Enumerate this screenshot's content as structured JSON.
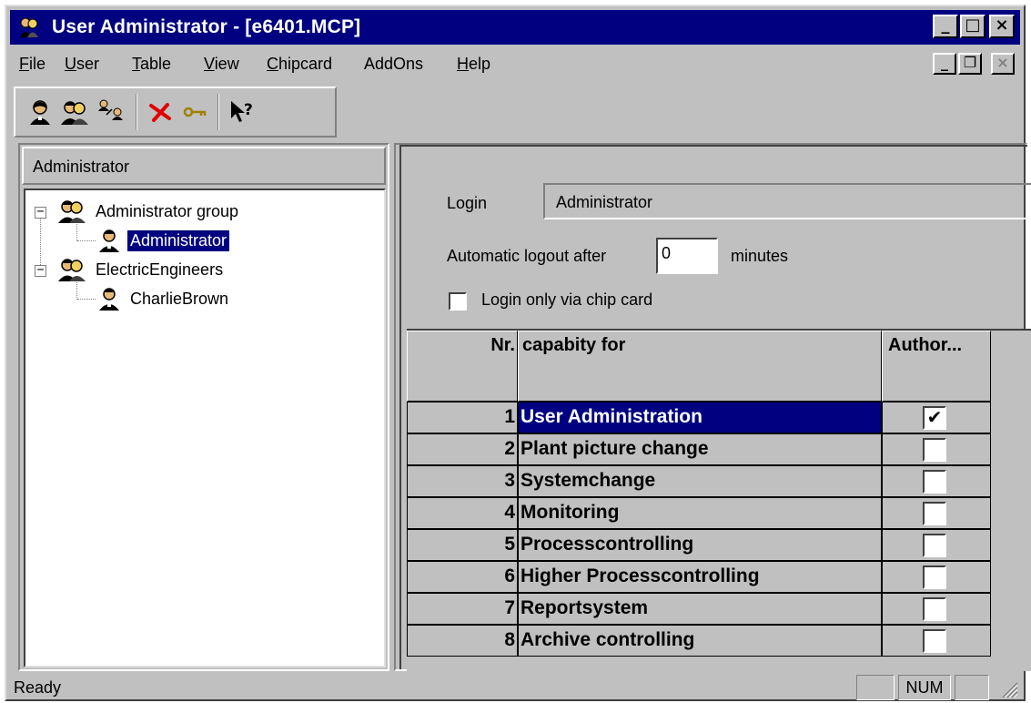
{
  "window": {
    "title": "User Administrator - [e6401.MCP]",
    "icon": "user-admin-app-icon",
    "controls": {
      "minimize": "_",
      "maximize": "□",
      "close": "×"
    }
  },
  "menubar": {
    "items": [
      {
        "first": "F",
        "rest": "ile"
      },
      {
        "first": "U",
        "rest": "ser"
      },
      {
        "first": "T",
        "rest": "able"
      },
      {
        "first": "V",
        "rest": "iew"
      },
      {
        "first": "C",
        "rest": "hipcard"
      },
      {
        "first": "",
        "rest": "AddOns"
      },
      {
        "first": "H",
        "rest": "elp"
      }
    ],
    "mdi_controls": {
      "minimize": "_",
      "restore": "❐",
      "close": "×"
    }
  },
  "toolbar": {
    "buttons": [
      "new-user-icon",
      "new-group-icon",
      "user-properties-icon",
      "delete-icon",
      "key-icon",
      "context-help-icon"
    ]
  },
  "left_pane": {
    "header": "Administrator",
    "tree": [
      {
        "label": "Administrator group",
        "type": "group",
        "expanded": true
      },
      {
        "label": "Administrator",
        "type": "user",
        "selected": true
      },
      {
        "label": "ElectricEngineers",
        "type": "group",
        "expanded": true
      },
      {
        "label": "CharlieBrown",
        "type": "user",
        "selected": false
      }
    ],
    "expander_symbol": "−"
  },
  "form": {
    "login_label": "Login",
    "login_value": "Administrator",
    "logout_label": "Automatic logout after",
    "logout_value": "0",
    "logout_unit": "minutes",
    "chipcard_label": "Login only via chip card",
    "chipcard_checked": false
  },
  "grid": {
    "headers": {
      "nr": "Nr.",
      "capability": "capabity for",
      "auth": "Author..."
    },
    "rows": [
      {
        "nr": "1",
        "capability": "User Administration",
        "authorized": true,
        "selected": true
      },
      {
        "nr": "2",
        "capability": "Plant picture change",
        "authorized": false,
        "selected": false
      },
      {
        "nr": "3",
        "capability": "Systemchange",
        "authorized": false,
        "selected": false
      },
      {
        "nr": "4",
        "capability": "Monitoring",
        "authorized": false,
        "selected": false
      },
      {
        "nr": "5",
        "capability": "Processcontrolling",
        "authorized": false,
        "selected": false
      },
      {
        "nr": "6",
        "capability": "Higher Processcontrolling",
        "authorized": false,
        "selected": false
      },
      {
        "nr": "7",
        "capability": "Reportsystem",
        "authorized": false,
        "selected": false
      },
      {
        "nr": "8",
        "capability": "Archive controlling",
        "authorized": false,
        "selected": false
      }
    ],
    "check_mark": "✔"
  },
  "statusbar": {
    "text": "Ready",
    "panels": [
      "",
      "NUM",
      ""
    ]
  },
  "colors": {
    "title_bar": "#000080",
    "face": "#c0c0c0",
    "selection": "#000080"
  }
}
